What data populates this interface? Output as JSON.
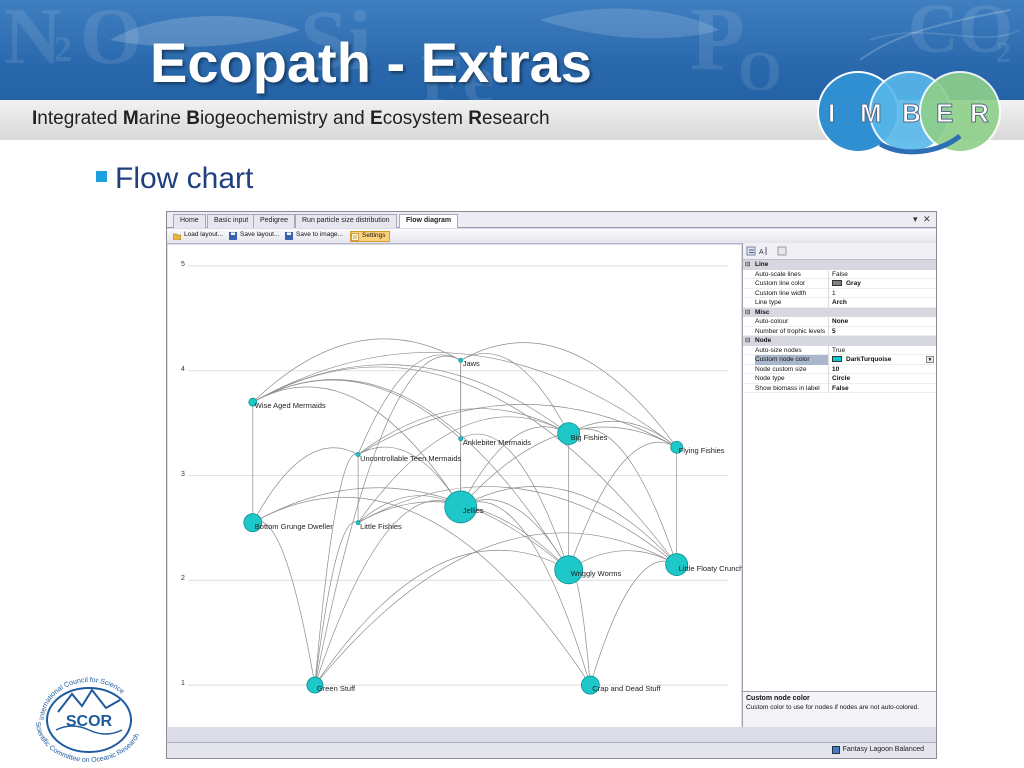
{
  "slide": {
    "title": "Ecopath - Extras",
    "subtitle_parts": [
      {
        "text": "I",
        "bold": true
      },
      {
        "text": "ntegrated ",
        "bold": false
      },
      {
        "text": "M",
        "bold": true
      },
      {
        "text": "arine ",
        "bold": false
      },
      {
        "text": "B",
        "bold": true
      },
      {
        "text": "iogeochemistry and ",
        "bold": false
      },
      {
        "text": "E",
        "bold": true
      },
      {
        "text": "cosystem ",
        "bold": false
      },
      {
        "text": "R",
        "bold": true
      },
      {
        "text": "esearch",
        "bold": false
      }
    ],
    "banner_deco": [
      "N",
      "2",
      "O",
      "Si",
      "Fe",
      "P",
      "O",
      "CO",
      "2"
    ],
    "imber_letters": [
      "I",
      "M",
      "B",
      "E",
      "R"
    ],
    "bullet": "Flow chart",
    "scor": {
      "top_text": "International Council for Science",
      "acronym": "SCOR",
      "bottom_text": "Scientific Committee on Oceanic Research"
    }
  },
  "colors": {
    "node_fill": "#1ec8c8",
    "node_stroke": "#0e8f94",
    "line": "#8c8c8c",
    "banner": "#2a69ad",
    "accent": "#1e9fe0"
  },
  "app": {
    "tabs": [
      "Home",
      "Basic input",
      "Pedigree",
      "Run particle size distribution",
      "Flow diagram"
    ],
    "active_tab": "Flow diagram",
    "window_controls": [
      "▾",
      "✕"
    ],
    "toolbar": [
      {
        "label": "Load layout...",
        "icon": "folder-icon"
      },
      {
        "label": "Save layout...",
        "icon": "save-icon"
      },
      {
        "label": "Save to image...",
        "icon": "save-icon"
      },
      {
        "label": "Settings",
        "icon": "settings-icon",
        "active": true
      }
    ],
    "properties": {
      "toolbar_icons": [
        "categorized-icon",
        "alphabetical-icon",
        "property-pages-icon"
      ],
      "sections": [
        {
          "name": "Line",
          "rows": [
            {
              "key": "Auto-scale lines",
              "value": "False"
            },
            {
              "key": "Custom line color",
              "value": "Gray",
              "swatch": "#808080",
              "bold": true
            },
            {
              "key": "Custom line width",
              "value": "1"
            },
            {
              "key": "Line type",
              "value": "Arch",
              "bold": true
            }
          ]
        },
        {
          "name": "Misc",
          "rows": [
            {
              "key": "Auto-colour",
              "value": "None",
              "bold": true
            },
            {
              "key": "Number of trophic levels",
              "value": "5",
              "bold": true
            }
          ]
        },
        {
          "name": "Node",
          "rows": [
            {
              "key": "Auto-size nodes",
              "value": "True"
            },
            {
              "key": "Custom node color",
              "value": "DarkTurquoise",
              "swatch": "#00ced1",
              "bold": true,
              "selected": true
            },
            {
              "key": "Node custom size",
              "value": "10",
              "bold": true
            },
            {
              "key": "Node type",
              "value": "Circle",
              "bold": true
            },
            {
              "key": "Show biomass in label",
              "value": "False",
              "bold": true
            }
          ]
        }
      ],
      "help_title": "Custom node color",
      "help_text": "Custom color to use for nodes if nodes are not auto-colored."
    },
    "status": {
      "scenario": "Fantasy Lagoon Balanced"
    }
  },
  "chart_data": {
    "type": "network",
    "ylim": [
      0.6,
      5.2
    ],
    "y_ticks": [
      1,
      2,
      3,
      4,
      5
    ],
    "nodes": [
      {
        "id": "jaws",
        "label": "Jaws",
        "x": 0.505,
        "tl": 4.1,
        "size": 2
      },
      {
        "id": "wam",
        "label": "Wise Aged Mermaids",
        "x": 0.12,
        "tl": 3.7,
        "size": 4
      },
      {
        "id": "akm",
        "label": "Anklebiter Mermaids",
        "x": 0.505,
        "tl": 3.35,
        "size": 1
      },
      {
        "id": "bf",
        "label": "Big Fishies",
        "x": 0.705,
        "tl": 3.4,
        "size": 11
      },
      {
        "id": "ff",
        "label": "Flying Fishies",
        "x": 0.905,
        "tl": 3.27,
        "size": 6
      },
      {
        "id": "utm",
        "label": "Uncontrollable Teen Mermaids",
        "x": 0.315,
        "tl": 3.2,
        "size": 2
      },
      {
        "id": "jel",
        "label": "Jellies",
        "x": 0.505,
        "tl": 2.7,
        "size": 16
      },
      {
        "id": "bgd",
        "label": "Bottom Grunge Dweller",
        "x": 0.12,
        "tl": 2.55,
        "size": 9
      },
      {
        "id": "lf",
        "label": "Little Fishies",
        "x": 0.315,
        "tl": 2.55,
        "size": 1
      },
      {
        "id": "ww",
        "label": "Wriggly Worms",
        "x": 0.705,
        "tl": 2.1,
        "size": 14
      },
      {
        "id": "lfc",
        "label": "Little Floaty Crunch",
        "x": 0.905,
        "tl": 2.15,
        "size": 11
      },
      {
        "id": "gs",
        "label": "Green Stuff",
        "x": 0.235,
        "tl": 1.0,
        "size": 8
      },
      {
        "id": "cds",
        "label": "Crap and Dead Stuff",
        "x": 0.745,
        "tl": 1.0,
        "size": 9
      }
    ],
    "edges": [
      [
        "wam",
        "jaws"
      ],
      [
        "wam",
        "bf"
      ],
      [
        "wam",
        "ff"
      ],
      [
        "wam",
        "jel"
      ],
      [
        "wam",
        "bgd"
      ],
      [
        "wam",
        "ww"
      ],
      [
        "wam",
        "lfc"
      ],
      [
        "wam",
        "akm"
      ],
      [
        "jaws",
        "bf"
      ],
      [
        "jaws",
        "ff"
      ],
      [
        "jaws",
        "jel"
      ],
      [
        "jaws",
        "akm"
      ],
      [
        "jaws",
        "gs"
      ],
      [
        "jaws",
        "utm"
      ],
      [
        "bf",
        "ff"
      ],
      [
        "bf",
        "jel"
      ],
      [
        "bf",
        "ww"
      ],
      [
        "bf",
        "lfc"
      ],
      [
        "bf",
        "utm"
      ],
      [
        "bf",
        "lf"
      ],
      [
        "ff",
        "jel"
      ],
      [
        "ff",
        "lfc"
      ],
      [
        "ff",
        "ww"
      ],
      [
        "ff",
        "utm"
      ],
      [
        "utm",
        "jel"
      ],
      [
        "utm",
        "gs"
      ],
      [
        "utm",
        "bgd"
      ],
      [
        "utm",
        "lf"
      ],
      [
        "jel",
        "gs"
      ],
      [
        "jel",
        "cds"
      ],
      [
        "jel",
        "ww"
      ],
      [
        "jel",
        "lf"
      ],
      [
        "jel",
        "lfc"
      ],
      [
        "bgd",
        "cds"
      ],
      [
        "bgd",
        "gs"
      ],
      [
        "bgd",
        "ww"
      ],
      [
        "lf",
        "gs"
      ],
      [
        "lf",
        "ww"
      ],
      [
        "lf",
        "lfc"
      ],
      [
        "ww",
        "gs"
      ],
      [
        "ww",
        "cds"
      ],
      [
        "ww",
        "lfc"
      ],
      [
        "lfc",
        "gs"
      ],
      [
        "lfc",
        "cds"
      ],
      [
        "akm",
        "jel"
      ],
      [
        "akm",
        "ww"
      ]
    ]
  }
}
